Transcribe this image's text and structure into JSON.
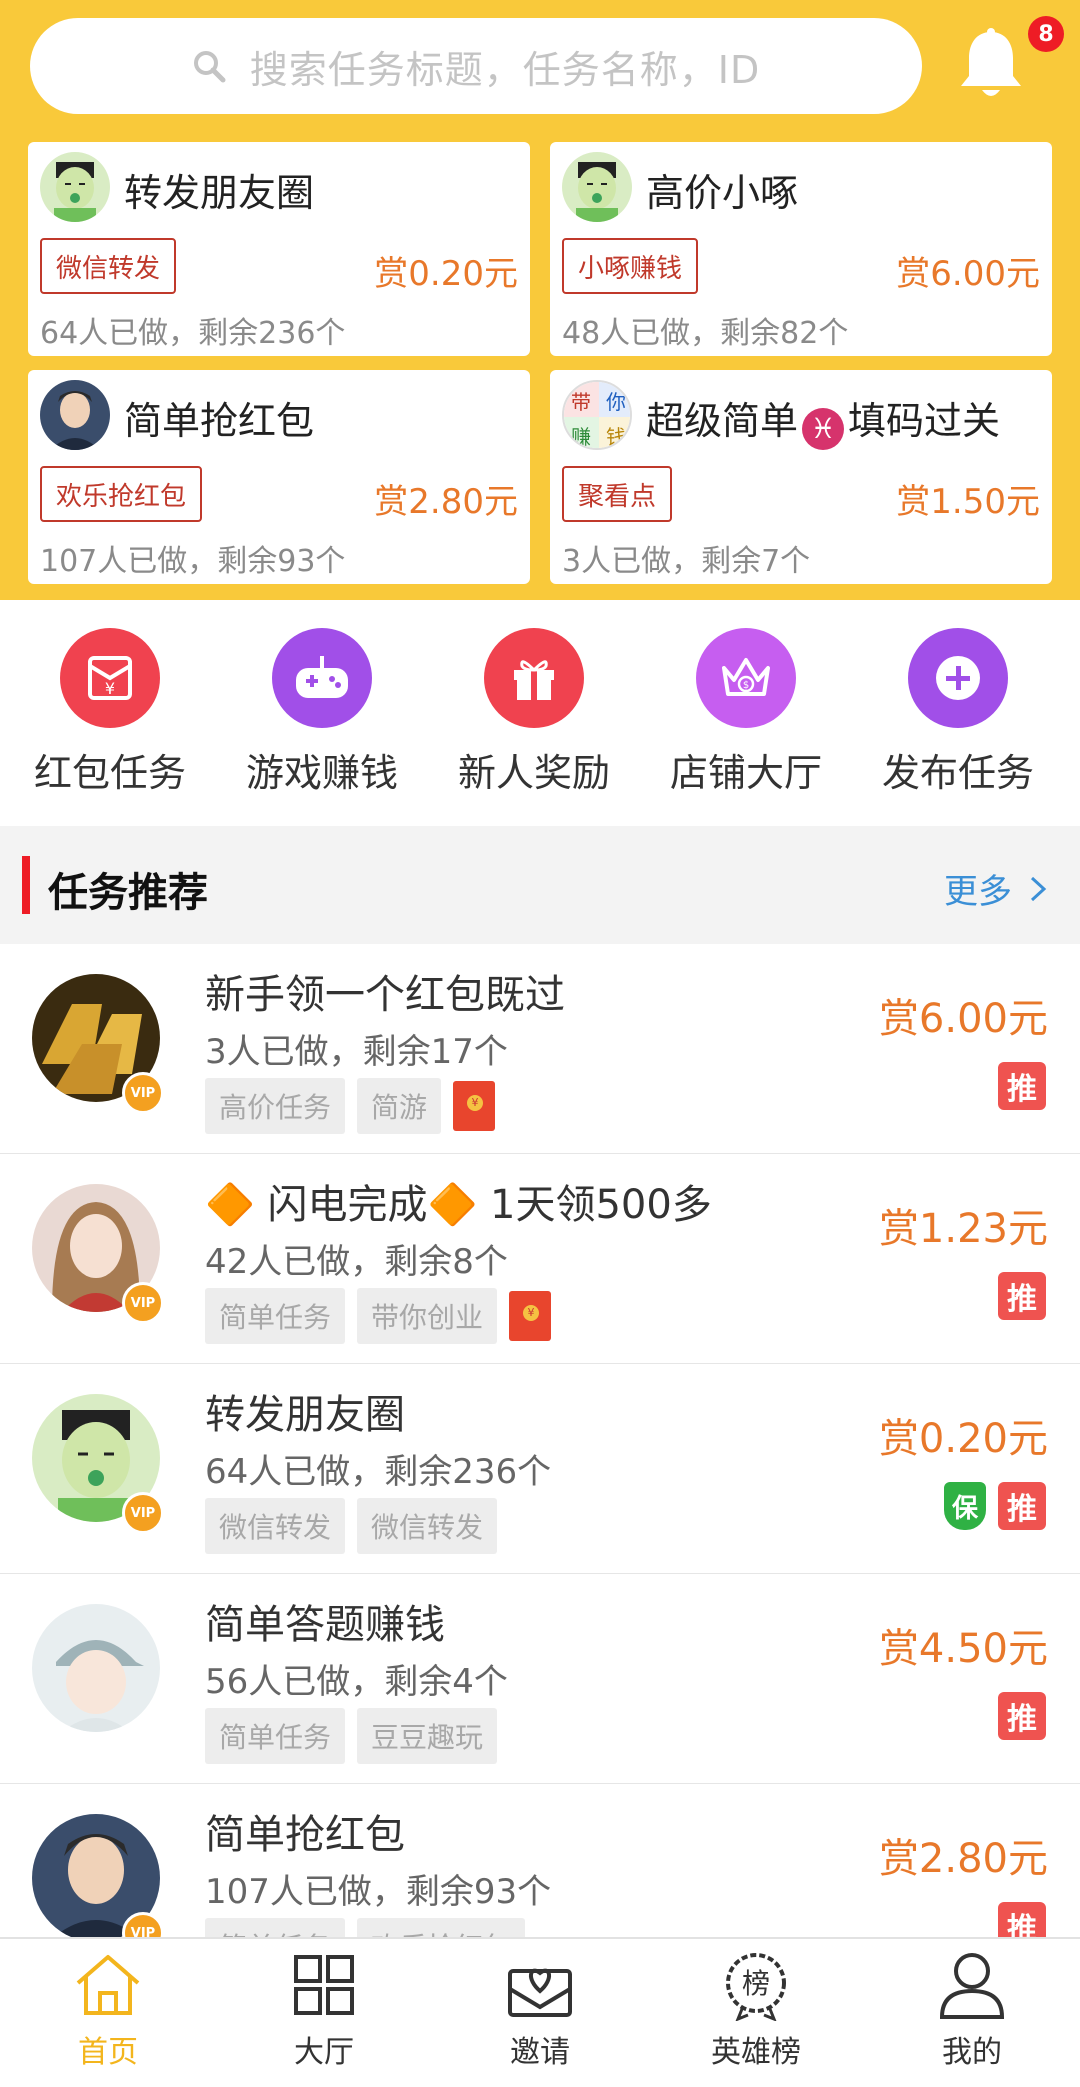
{
  "search": {
    "placeholder": "搜索任务标题，任务名称，ID"
  },
  "notifications": {
    "count": "8"
  },
  "top_cards": [
    {
      "title": "转发朋友圈",
      "tag": "微信转发",
      "reward": "赏0.20元",
      "stats": "64人已做，剩余236个",
      "avatar": "cartoon-boy"
    },
    {
      "title": "高价小啄",
      "tag": "小啄赚钱",
      "reward": "赏6.00元",
      "stats": "48人已做，剩余82个",
      "avatar": "cartoon-boy"
    },
    {
      "title": "简单抢红包",
      "tag": "欢乐抢红包",
      "reward": "赏2.80元",
      "stats": "107人已做，剩余93个",
      "avatar": "man-photo"
    },
    {
      "title_a": "超级简单",
      "title_symbol": "♓",
      "title_b": "填码过关",
      "tag": "聚看点",
      "reward": "赏1.50元",
      "stats": "3人已做，剩余7个",
      "avatar": "dai-ni-zhuan-qian",
      "avatar_chars": [
        "带",
        "你",
        "赚",
        "钱"
      ]
    }
  ],
  "categories": [
    {
      "label": "红包任务",
      "icon": "red-envelope-icon",
      "color": "#f0424f"
    },
    {
      "label": "游戏赚钱",
      "icon": "gamepad-icon",
      "color": "#a14fe8"
    },
    {
      "label": "新人奖励",
      "icon": "gift-icon",
      "color": "#f0424f"
    },
    {
      "label": "店铺大厅",
      "icon": "crown-icon",
      "color": "#c65ef0"
    },
    {
      "label": "发布任务",
      "icon": "plus-circle-icon",
      "color": "#a14fe8"
    }
  ],
  "section": {
    "title": "任务推荐",
    "more": "更多"
  },
  "tasks": [
    {
      "title": "新手领一个红包既过",
      "stats": "3人已做，剩余17个",
      "tags": [
        "高价任务",
        "简游"
      ],
      "envelope": true,
      "reward": "赏6.00元",
      "badges": [
        "推"
      ]
    },
    {
      "title": "🔶 闪电完成🔶 1天领500多",
      "stats": "42人已做，剩余8个",
      "tags": [
        "简单任务",
        "带你创业"
      ],
      "envelope": true,
      "reward": "赏1.23元",
      "badges": [
        "推"
      ]
    },
    {
      "title": "转发朋友圈",
      "stats": "64人已做，剩余236个",
      "tags": [
        "微信转发",
        "微信转发"
      ],
      "envelope": false,
      "reward": "赏0.20元",
      "badges": [
        "保",
        "推"
      ]
    },
    {
      "title": "简单答题赚钱",
      "stats": "56人已做，剩余4个",
      "tags": [
        "简单任务",
        "豆豆趣玩"
      ],
      "envelope": false,
      "reward": "赏4.50元",
      "badges": [
        "推"
      ]
    },
    {
      "title": "简单抢红包",
      "stats": "107人已做，剩余93个",
      "tags": [
        "简单任务",
        "欢乐抢红包"
      ],
      "envelope": false,
      "reward": "赏2.80元",
      "badges": [
        "推"
      ]
    }
  ],
  "vip_label": "VIP",
  "bottom_nav": [
    {
      "label": "首页",
      "icon": "home-icon",
      "active": true
    },
    {
      "label": "大厅",
      "icon": "grid-icon",
      "active": false
    },
    {
      "label": "邀请",
      "icon": "invite-envelope-icon",
      "active": false
    },
    {
      "label": "英雄榜",
      "icon": "ranking-badge-icon",
      "active": false,
      "icon_char": "榜"
    },
    {
      "label": "我的",
      "icon": "user-icon",
      "active": false
    }
  ],
  "colors": {
    "header_bg": "#f9c93a",
    "reward": "#e8782a",
    "active_nav": "#f3b51d",
    "accent_red": "#ee1c25"
  }
}
